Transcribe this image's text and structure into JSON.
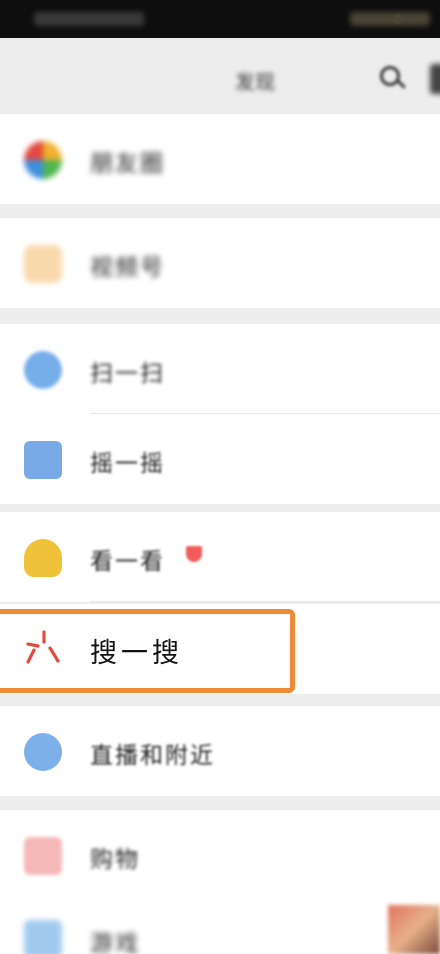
{
  "statusbar": {
    "time_text": ""
  },
  "navbar": {
    "title": "发现"
  },
  "menu": {
    "moments": "朋友圈",
    "channels": "视频号",
    "scan": "扫一扫",
    "shake": "摇一摇",
    "top_stories": "看一看",
    "search": "搜一搜",
    "nearby": "直播和附近",
    "shopping": "购物",
    "games": "游戏"
  },
  "colors": {
    "highlight_border": "#ef8a36",
    "badge": "#f15b5b",
    "background": "#ededed"
  },
  "icons": {
    "moments": "moments-icon",
    "channels": "channels-icon",
    "scan": "scan-icon",
    "shake": "shake-icon",
    "top_stories": "top-stories-icon",
    "search": "sousou-icon",
    "nearby": "nearby-icon",
    "shopping": "shopping-bag-icon",
    "games": "games-icon",
    "search_nav": "search-icon"
  }
}
